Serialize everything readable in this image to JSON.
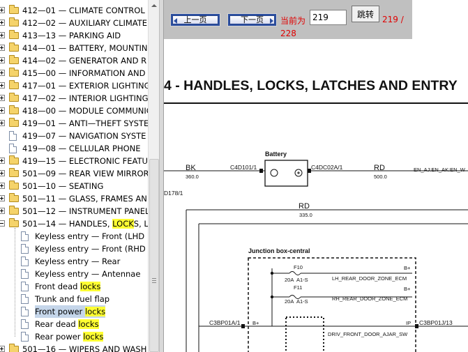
{
  "tree": {
    "items": [
      {
        "label": "412—01 — CLIMATE CONTROL",
        "type": "folder",
        "expanded": false
      },
      {
        "label": "412—02 — AUXILIARY CLIMATE",
        "type": "folder",
        "expanded": false
      },
      {
        "label": "413—13 — PARKING AID",
        "type": "folder",
        "expanded": false
      },
      {
        "label": "414—01 — BATTERY, MOUNTING",
        "type": "folder",
        "expanded": false
      },
      {
        "label": "414—02 — GENERATOR AND R",
        "type": "folder",
        "expanded": false
      },
      {
        "label": "415—00 — INFORMATION AND",
        "type": "folder",
        "expanded": false
      },
      {
        "label": "417—01 — EXTERIOR LIGHTING",
        "type": "folder",
        "expanded": false
      },
      {
        "label": "417—02 — INTERIOR LIGHTING",
        "type": "folder",
        "expanded": false
      },
      {
        "label": "418—00 — MODULE COMMUNIC",
        "type": "folder",
        "expanded": false
      },
      {
        "label": "419—01 — ANTI—THEFT SYSTE",
        "type": "folder",
        "expanded": false
      },
      {
        "label": "419—07 — NAVIGATION SYSTE",
        "type": "doc"
      },
      {
        "label": "419—08 — CELLULAR PHONE",
        "type": "doc"
      },
      {
        "label": "419—15 — ELECTRONIC FEATU",
        "type": "folder",
        "expanded": false
      },
      {
        "label": "501—09 — REAR VIEW MIRROR",
        "type": "folder",
        "expanded": false
      },
      {
        "label": "501—10 — SEATING",
        "type": "folder",
        "expanded": false
      },
      {
        "label": "501—11 — GLASS, FRAMES AN",
        "type": "folder",
        "expanded": false
      },
      {
        "label": "501—12 — INSTRUMENT PANEL",
        "type": "folder",
        "expanded": false
      },
      {
        "label": "501—14 — HANDLES, ",
        "hl": "LOCK",
        "post": "S, L",
        "type": "folder",
        "expanded": true
      },
      {
        "label": "Keyless entry — Front (LHD",
        "type": "doc",
        "child": true
      },
      {
        "label": "Keyless entry — Front (RHD",
        "type": "doc",
        "child": true
      },
      {
        "label": "Keyless entry — Rear",
        "type": "doc",
        "child": true
      },
      {
        "label": "Keyless entry — Antennae",
        "type": "doc",
        "child": true
      },
      {
        "label": "Front dead ",
        "hl": "locks",
        "post": "",
        "type": "doc",
        "child": true
      },
      {
        "label": "Trunk and fuel flap",
        "type": "doc",
        "child": true
      },
      {
        "label": "Front power ",
        "hl": "locks",
        "post": "",
        "type": "doc",
        "child": true,
        "selected": true
      },
      {
        "label": "Rear dead ",
        "hl": "locks",
        "post": "",
        "type": "doc",
        "child": true
      },
      {
        "label": "Rear power ",
        "hl": "locks",
        "post": "",
        "type": "doc",
        "child": true
      },
      {
        "label": "501—16 — WIPERS AND WASH",
        "type": "folder",
        "expanded": false
      }
    ]
  },
  "toolbar": {
    "prev_label": "上一页",
    "next_label": "下一页",
    "current_label": "当前为",
    "page_value": "219",
    "jump_label": "跳转",
    "page_info_line1": "219 /",
    "page_info_line2": "228"
  },
  "document": {
    "title": "4 - HANDLES, LOCKS, LATCHES AND ENTRY"
  },
  "diagram": {
    "wire_bk": "BK",
    "wire_bk_size": "360.0",
    "conn_c4d101": "C4D101/1",
    "battery_label": "Battery",
    "conn_c4dc02a": "C4DC02A/1",
    "wire_rd_top": "RD",
    "wire_rd_top_size": "500.0",
    "net_right": "EN_AJ:EN_AK:EN_W",
    "conn_d178": "D178/1",
    "wire_rd_mid": "RD",
    "wire_rd_mid_size": "335.0",
    "jbox_label": "Junction box-central",
    "fuse1": "F10",
    "fuse1_rating": "20A",
    "fuse1_loc": "A1-S",
    "fuse1_net": "LH_REAR_DOOR_ZONE_ECM",
    "bplus1": "B+",
    "fuse2": "F11",
    "fuse2_rating": "20A",
    "fuse2_loc": "A1-S",
    "fuse2_net": "RH_REAR_DOOR_ZONE_ECM",
    "bplus2": "B+",
    "conn_c3bp01a": "C3BP01A/1",
    "bplus3": "B+",
    "ip_label": "IP",
    "conn_c3bp01j": "C3BP01J/13",
    "net_driv": "DRIV_FRONT_DOOR_AJAR_SW"
  }
}
